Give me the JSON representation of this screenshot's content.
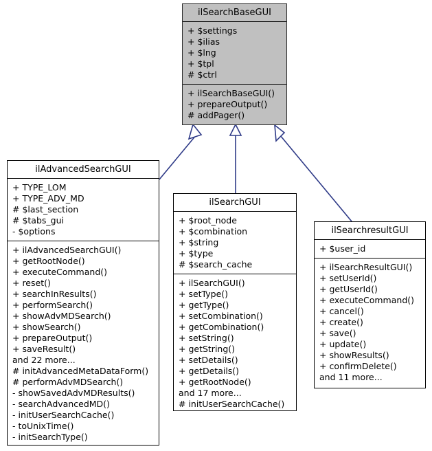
{
  "diagram": {
    "kind": "uml-class-inheritance-diagram",
    "colors": {
      "base_class_fill": "#c0c0c0",
      "class_fill": "#ffffff",
      "border": "#000000",
      "edge": "#2e3a87",
      "background": "#ffffff"
    }
  },
  "classes": {
    "base": {
      "name": "ilSearchBaseGUI",
      "attributes": [
        "+ $settings",
        "+ $ilias",
        "+ $lng",
        "+ $tpl",
        "# $ctrl"
      ],
      "operations": [
        "+ ilSearchBaseGUI()",
        "+ prepareOutput()",
        "# addPager()"
      ]
    },
    "advanced": {
      "name": "ilAdvancedSearchGUI",
      "attributes": [
        "+ TYPE_LOM",
        "+ TYPE_ADV_MD",
        "# $last_section",
        "# $tabs_gui",
        "- $options"
      ],
      "operations": [
        "+ ilAdvancedSearchGUI()",
        "+ getRootNode()",
        "+ executeCommand()",
        "+ reset()",
        "+ searchInResults()",
        "+ performSearch()",
        "+ showAdvMDSearch()",
        "+ showSearch()",
        "+ prepareOutput()",
        "+ saveResult()",
        "and 22 more...",
        "# initAdvancedMetaDataForm()",
        "# performAdvMDSearch()",
        "- showSavedAdvMDResults()",
        "- searchAdvancedMD()",
        "- initUserSearchCache()",
        "- toUnixTime()",
        "- initSearchType()"
      ]
    },
    "search": {
      "name": "ilSearchGUI",
      "attributes": [
        "+ $root_node",
        "+ $combination",
        "+ $string",
        "+ $type",
        "# $search_cache"
      ],
      "operations": [
        "+ ilSearchGUI()",
        "+ setType()",
        "+ getType()",
        "+ setCombination()",
        "+ getCombination()",
        "+ setString()",
        "+ getString()",
        "+ setDetails()",
        "+ getDetails()",
        "+ getRootNode()",
        "and 17 more...",
        "# initUserSearchCache()"
      ]
    },
    "result": {
      "name": "ilSearchresultGUI",
      "attributes": [
        "+ $user_id"
      ],
      "operations": [
        "+ ilSearchResultGUI()",
        "+ setUserId()",
        "+ getUserId()",
        "+ executeCommand()",
        "+ cancel()",
        "+ create()",
        "+ save()",
        "+ update()",
        "+ showResults()",
        "+ confirmDelete()",
        "and 11 more..."
      ]
    }
  },
  "relationships": [
    {
      "type": "inheritance",
      "from": "ilAdvancedSearchGUI",
      "to": "ilSearchBaseGUI"
    },
    {
      "type": "inheritance",
      "from": "ilSearchGUI",
      "to": "ilSearchBaseGUI"
    },
    {
      "type": "inheritance",
      "from": "ilSearchresultGUI",
      "to": "ilSearchBaseGUI"
    }
  ]
}
